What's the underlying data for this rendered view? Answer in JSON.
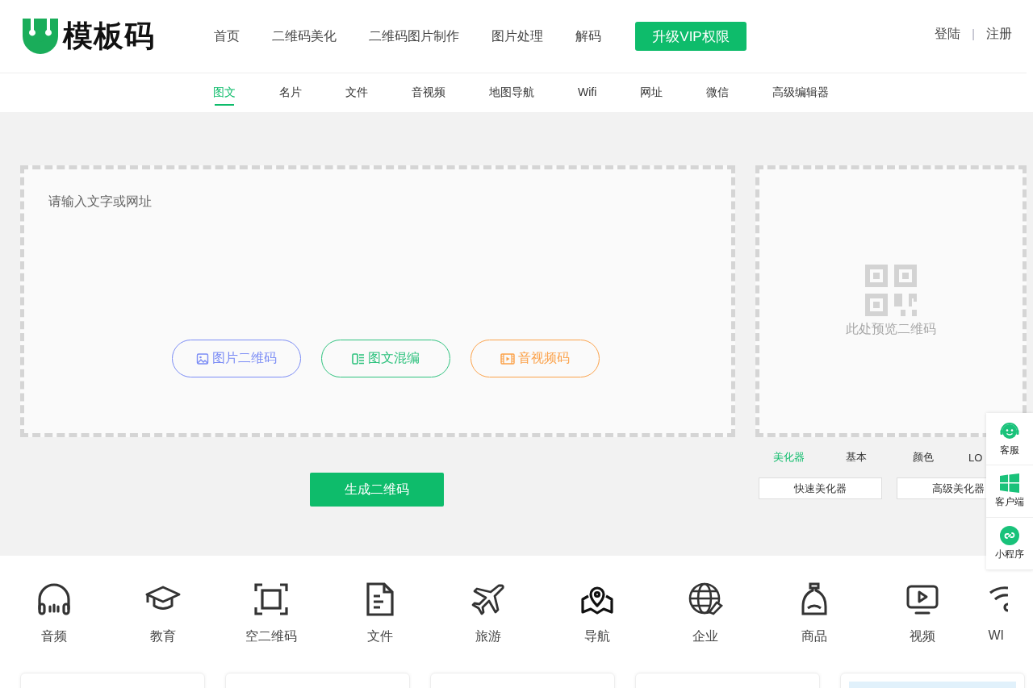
{
  "header": {
    "logo": "模板码",
    "nav": [
      {
        "label": "首页"
      },
      {
        "label": "二维码美化"
      },
      {
        "label": "二维码图片制作"
      },
      {
        "label": "图片处理"
      },
      {
        "label": "解码"
      }
    ],
    "vip_button": "升级VIP权限",
    "login": "登陆",
    "separator": "|",
    "register": "注册"
  },
  "subnav": [
    {
      "label": "图文",
      "selected": true
    },
    {
      "label": "名片",
      "selected": false
    },
    {
      "label": "文件",
      "selected": false
    },
    {
      "label": "音视频",
      "selected": false
    },
    {
      "label": "地图导航",
      "selected": false
    },
    {
      "label": "Wifi",
      "selected": false
    },
    {
      "label": "网址",
      "selected": false
    },
    {
      "label": "微信",
      "selected": false
    },
    {
      "label": "高级编辑器",
      "selected": false
    }
  ],
  "editor": {
    "placeholder": "请输入文字或网址",
    "buttons": [
      {
        "label": "图片二维码",
        "color": "#7b8cf5"
      },
      {
        "label": "图文混编",
        "color": "#2ec27e"
      },
      {
        "label": "音视频码",
        "color": "#fba24a"
      }
    ],
    "generate_button": "生成二维码"
  },
  "preview": {
    "empty_message": "此处预览二维码",
    "tabs": [
      {
        "label": "美化器",
        "selected": true
      },
      {
        "label": "基本",
        "selected": false
      },
      {
        "label": "颜色",
        "selected": false
      },
      {
        "label": "LO",
        "selected": false
      }
    ],
    "buttons": [
      "快速美化器",
      "高级美化器"
    ]
  },
  "float_sidebar": [
    {
      "label": "客服"
    },
    {
      "label": "客户端"
    },
    {
      "label": "小程序"
    }
  ],
  "categories": [
    {
      "label": "音频"
    },
    {
      "label": "教育"
    },
    {
      "label": "空二维码"
    },
    {
      "label": "文件"
    },
    {
      "label": "旅游"
    },
    {
      "label": "导航"
    },
    {
      "label": "企业"
    },
    {
      "label": "商品"
    },
    {
      "label": "视频"
    },
    {
      "label": "WI"
    }
  ],
  "cards": [
    {
      "kind": "blank"
    },
    {
      "kind": "blank"
    },
    {
      "kind": "blank"
    },
    {
      "kind": "blank"
    },
    {
      "kind": "banner"
    }
  ]
}
